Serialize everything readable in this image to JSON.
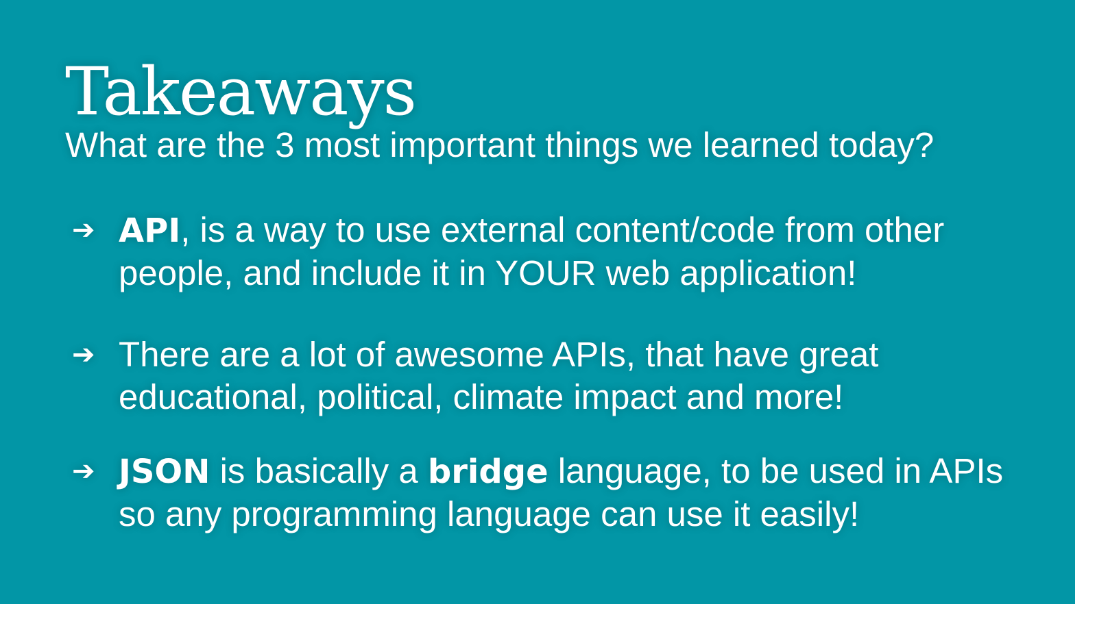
{
  "colors": {
    "background": "#0296a6",
    "text": "#ffffff"
  },
  "slide": {
    "title": "Takeaways",
    "subtitle": "What are the 3 most important things we learned today?",
    "bullet_icon": "right-arrow-icon",
    "bullet_glyph": "➔",
    "bullets": [
      {
        "bold_1": "API",
        "text_1": ", is a way to use external content/code from other people, and include it in YOUR web application!"
      },
      {
        "text_1": "There are a lot of awesome APIs, that have great educational, political, climate impact and more!"
      },
      {
        "bold_1": "JSON",
        "text_1": " is basically a ",
        "bold_2": "bridge",
        "text_2": " language, to be used in APIs so any programming language can use it easily!"
      }
    ]
  }
}
